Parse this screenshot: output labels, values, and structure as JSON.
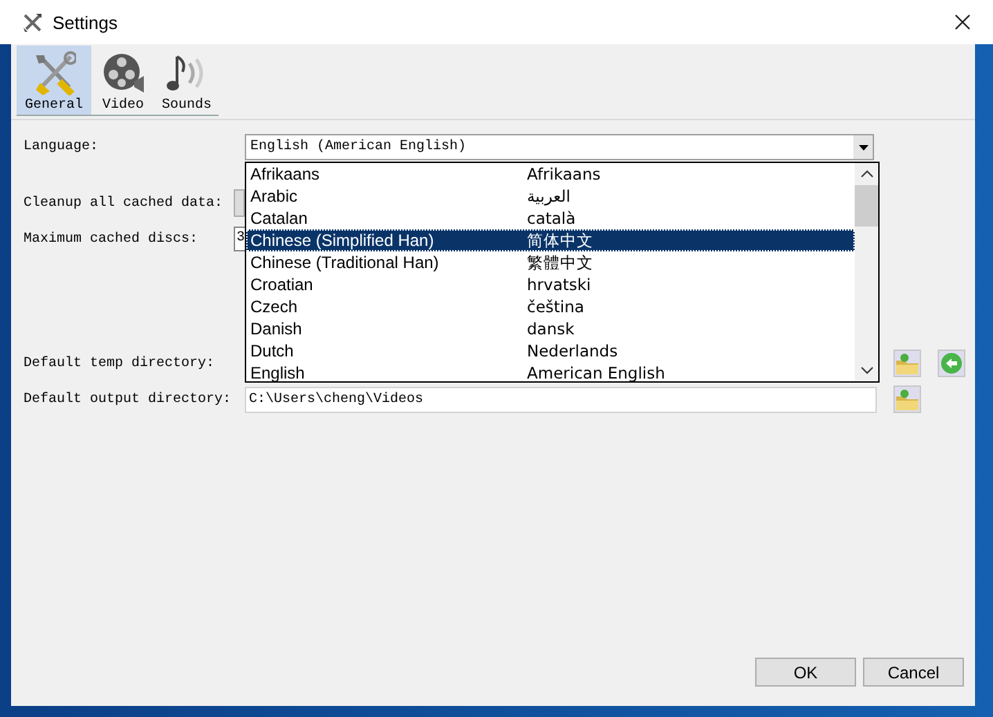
{
  "window": {
    "title": "Settings"
  },
  "tabs": [
    {
      "label": "General",
      "selected": true
    },
    {
      "label": "Video",
      "selected": false
    },
    {
      "label": "Sounds",
      "selected": false
    }
  ],
  "cache_settings": [
    {
      "kind": "combo",
      "label": "Language:",
      "value": "English (American English)"
    },
    {
      "kind": "button",
      "label": "Cleanup all cached data:"
    },
    {
      "kind": "field",
      "label": "Maximum cached discs:",
      "value": "3"
    }
  ],
  "directories": [
    {
      "label": "Default temp directory:",
      "reset_button": true
    },
    {
      "label": "Default output directory:",
      "value": "C:\\Users\\cheng\\Videos",
      "reset_button": false
    }
  ],
  "language_list": [
    {
      "name": "Afrikaans",
      "native": "Afrikaans",
      "selected": false
    },
    {
      "name": "Arabic",
      "native": "العربية",
      "selected": false
    },
    {
      "name": "Catalan",
      "native": "català",
      "selected": false
    },
    {
      "name": "Chinese (Simplified Han)",
      "native": "简体中文",
      "selected": true
    },
    {
      "name": "Chinese (Traditional Han)",
      "native": "繁體中文",
      "selected": false
    },
    {
      "name": "Croatian",
      "native": "hrvatski",
      "selected": false
    },
    {
      "name": "Czech",
      "native": "čeština",
      "selected": false
    },
    {
      "name": "Danish",
      "native": "dansk",
      "selected": false
    },
    {
      "name": "Dutch",
      "native": "Nederlands",
      "selected": false
    },
    {
      "name": "English",
      "native": "American English",
      "selected": false
    }
  ],
  "buttons": [
    "OK",
    "Cancel"
  ]
}
